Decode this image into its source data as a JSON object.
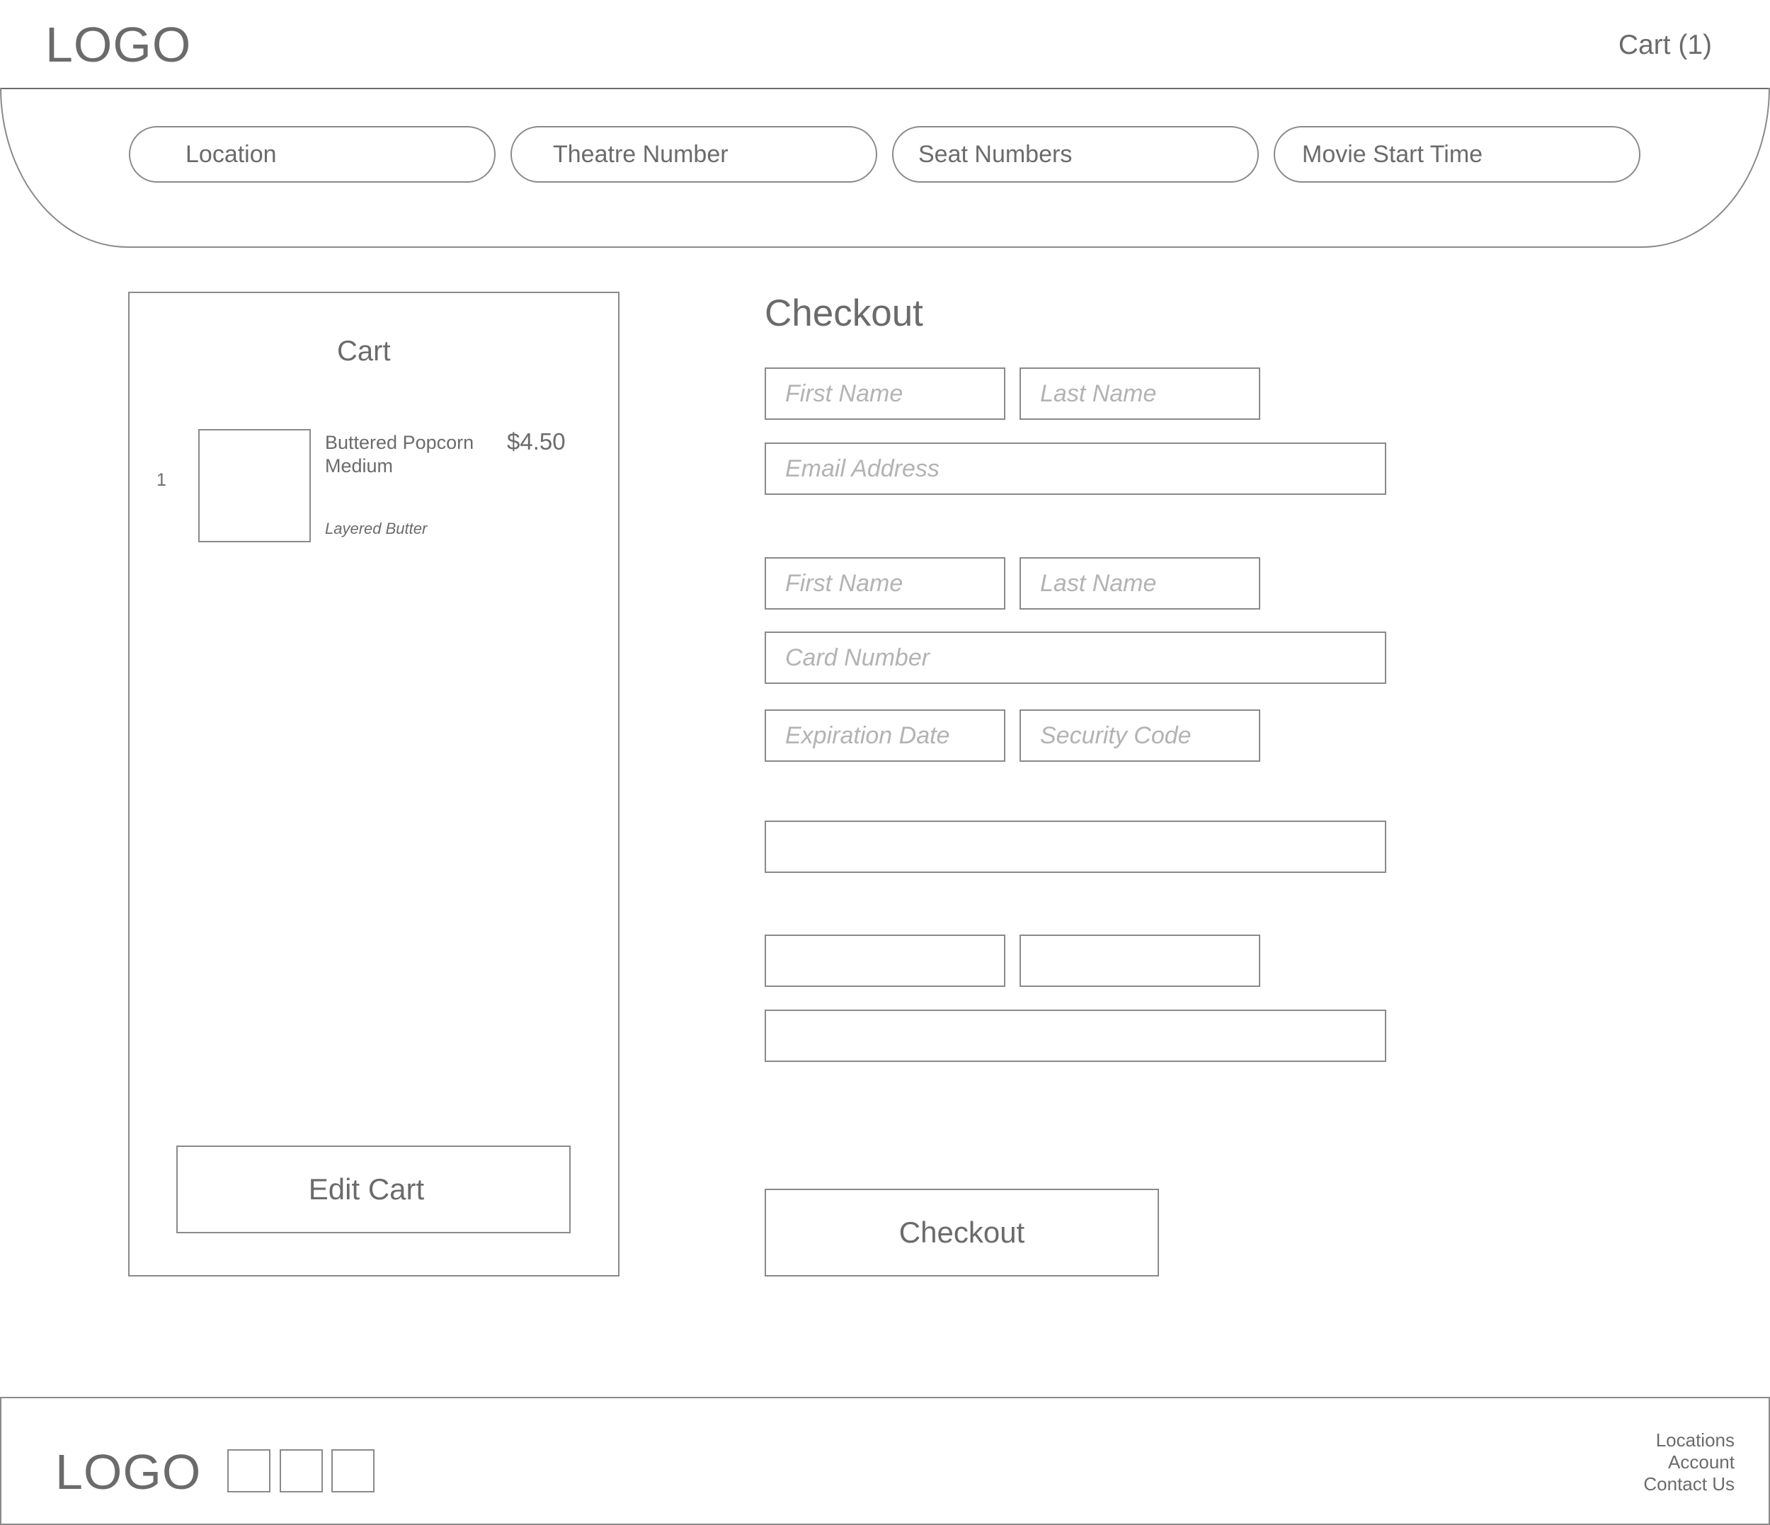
{
  "header": {
    "logo": "LOGO",
    "cart_link": "Cart (1)"
  },
  "filters": [
    {
      "label": "Location"
    },
    {
      "label": "Theatre Number"
    },
    {
      "label": "Seat Numbers"
    },
    {
      "label": "Movie Start Time"
    }
  ],
  "cart": {
    "title": "Cart",
    "items": [
      {
        "quantity": "1",
        "name": "Buttered Popcorn Medium",
        "price": "$4.50",
        "option": "Layered Butter"
      }
    ],
    "edit_button": "Edit Cart"
  },
  "checkout": {
    "title": "Checkout",
    "contact": {
      "first_name_placeholder": "First Name",
      "last_name_placeholder": "Last Name",
      "email_placeholder": "Email Address"
    },
    "payment": {
      "first_name_placeholder": "First Name",
      "last_name_placeholder": "Last Name",
      "card_number_placeholder": "Card Number",
      "expiration_placeholder": "Expiration Date",
      "security_code_placeholder": "Security Code"
    },
    "submit_button": "Checkout"
  },
  "footer": {
    "logo": "LOGO",
    "links": [
      "Locations",
      "Account",
      "Contact Us"
    ]
  }
}
